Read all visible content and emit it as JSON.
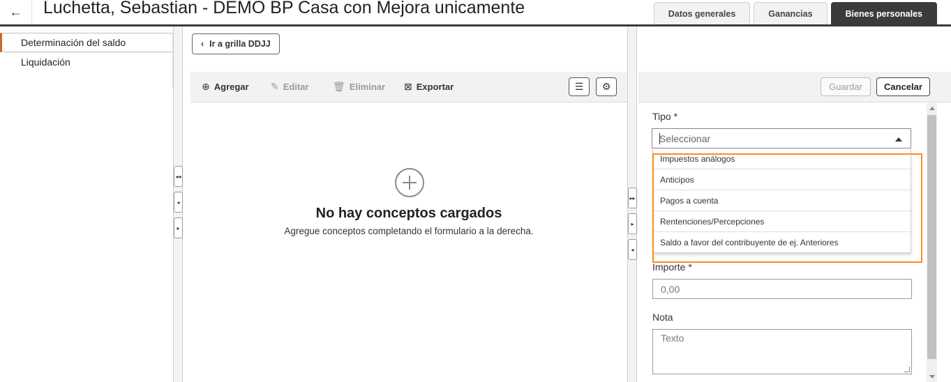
{
  "header": {
    "back_icon": "←",
    "title": "Luchetta, Sebastian - DEMO BP Casa con Mejora unicamente",
    "tabs": [
      "Datos generales",
      "Ganancias",
      "Bienes personales"
    ]
  },
  "sidebar": {
    "items": [
      {
        "label": "Determinación del saldo"
      },
      {
        "label": "Liquidación"
      }
    ]
  },
  "top_action": {
    "back_icon": "‹",
    "label": "Ir a grilla DDJJ"
  },
  "grid": {
    "toolbar": {
      "add": {
        "icon": "⊕",
        "label": "Agregar"
      },
      "edit": {
        "icon": "✎",
        "label": "Editar"
      },
      "delete": {
        "icon": "🗑",
        "label": "Eliminar"
      },
      "export": {
        "icon": "⊠",
        "label": "Exportar"
      },
      "columns_icon": "☰",
      "settings_icon": "⚙"
    },
    "empty": {
      "title": "No hay conceptos cargados",
      "subtitle": "Agregue conceptos completando el formulario a la derecha."
    }
  },
  "form": {
    "save_label": "Guardar",
    "cancel_label": "Cancelar",
    "tipo_label": "Tipo *",
    "tipo_placeholder": "Seleccionar",
    "tipo_options": [
      "Impuestos análogos",
      "Anticipos",
      "Pagos a cuenta",
      "Rentenciones/Percepciones",
      "Saldo a favor del contribuyente de ej. Anteriores"
    ],
    "importe_label": "Importe *",
    "importe_placeholder": "0,00",
    "nota_label": "Nota",
    "nota_placeholder": "Texto"
  },
  "separators": {
    "collapse_all_icon": "◂◂",
    "left_icon": "◂",
    "right_icon": "▸",
    "expand_all_icon": "▸▸"
  },
  "colors": {
    "accent": "#c86a2c",
    "highlight": "#ff8c1a",
    "active_tab": "#3b3b3b"
  }
}
